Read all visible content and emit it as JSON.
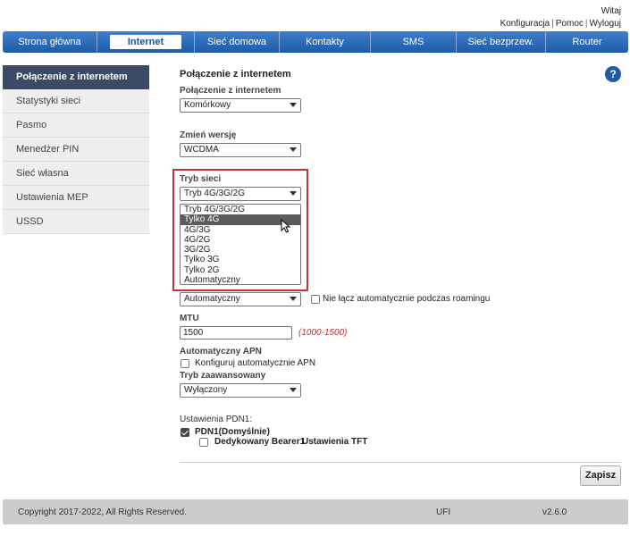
{
  "header": {
    "greeting": "Witaj",
    "links": [
      "Konfiguracja",
      "Pomoc",
      "Wyloguj"
    ]
  },
  "nav": {
    "tabs": [
      "Strona główna",
      "Internet",
      "Sieć domowa",
      "Kontakty",
      "SMS",
      "Sieć bezprzew.",
      "Router"
    ],
    "active": "Internet"
  },
  "sidebar": {
    "items": [
      "Połączenie z internetem",
      "Statystyki sieci",
      "Pasmo",
      "Menedżer PIN",
      "Sieć własna",
      "Ustawienia MEP",
      "USSD"
    ],
    "active": "Połączenie z internetem"
  },
  "help_icon": "?",
  "main": {
    "title": "Połączenie z internetem",
    "connection": {
      "label": "Połączenie z internetem",
      "value": "Komórkowy"
    },
    "version": {
      "label": "Zmień wersję",
      "value": "WCDMA"
    },
    "network_mode": {
      "label": "Tryb sieci",
      "value": "Tryb 4G/3G/2G",
      "options": [
        "Tryb 4G/3G/2G",
        "Tylko 4G",
        "4G/3G",
        "4G/2G",
        "3G/2G",
        "Tylko 3G",
        "Tylko 2G",
        "Automatyczny"
      ],
      "highlighted": "Tylko 4G"
    },
    "connect_mode": {
      "value": "Automatyczny",
      "roaming_label": "Nie łącz automatycznie podczas roamingu",
      "roaming_checked": false
    },
    "mtu": {
      "label": "MTU",
      "value": "1500",
      "hint": "(1000-1500)"
    },
    "apn": {
      "label": "Automatyczny APN",
      "checkbox_label": "Konfiguruj automatycznie APN",
      "checked": false
    },
    "advanced": {
      "label": "Tryb zaawansowany",
      "value": "Wyłączony"
    },
    "pdn": {
      "label": "Ustawienia PDN1:",
      "default_label": "PDN1(Domyślnie)",
      "default_checked": true,
      "bearer_label": "Dedykowany Bearer1",
      "tft_label": "Ustawienia TFT",
      "bearer_checked": false
    },
    "save_label": "Zapisz"
  },
  "footer": {
    "copyright": "Copyright 2017-2022, All Rights Reserved.",
    "device": "UFI",
    "version": "v2.6.0"
  },
  "colors": {
    "nav_blue": "#1e5aa8",
    "sidebar_active": "#3b4a66",
    "highlight_box": "#c93030",
    "hint_red": "#b03030"
  }
}
